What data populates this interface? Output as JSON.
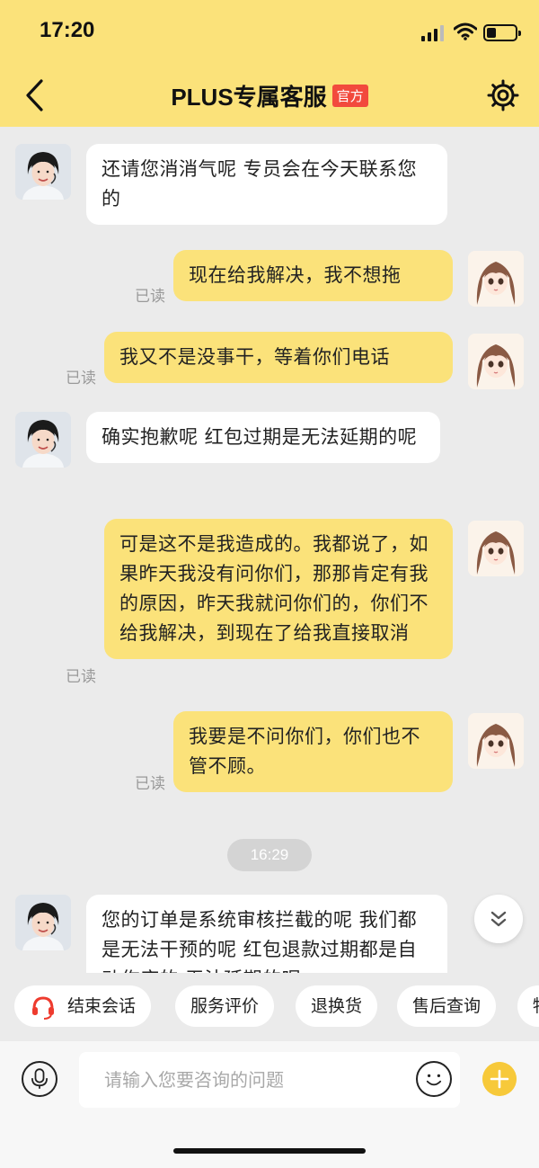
{
  "status_bar": {
    "time": "17:20"
  },
  "header": {
    "title": "PLUS专属客服",
    "badge": "官方"
  },
  "messages": [
    {
      "text": "还请您消消气呢  专员会在今天联系您的"
    },
    {
      "text": "现在给我解决，我不想拖",
      "read": "已读"
    },
    {
      "text": "我又不是没事干，等着你们电话",
      "read": "已读"
    },
    {
      "text": "确实抱歉呢 红包过期是无法延期的呢"
    },
    {
      "text": "可是这不是我造成的。我都说了，如果昨天我没有问你们，那那肯定有我的原因，昨天我就问你们的，你们不给我解决，到现在了给我直接取消",
      "read": "已读"
    },
    {
      "text": "我要是不问你们，你们也不管不顾。",
      "read": "已读"
    },
    {
      "text": "您的订单是系统审核拦截的呢 我们都是无法干预的呢  红包退款过期都是自动作废的 无法延期的呢"
    }
  ],
  "time_divider": "16:29",
  "quick_replies": [
    "结束会话",
    "服务评价",
    "退换货",
    "售后查询",
    "物"
  ],
  "input": {
    "placeholder": "请输入您要咨询的问题"
  },
  "colors": {
    "header_bg": "#fbe27a",
    "outgoing_bubble": "#fbe27a",
    "badge": "#f24a3d",
    "plus_button": "#f7c93a"
  }
}
